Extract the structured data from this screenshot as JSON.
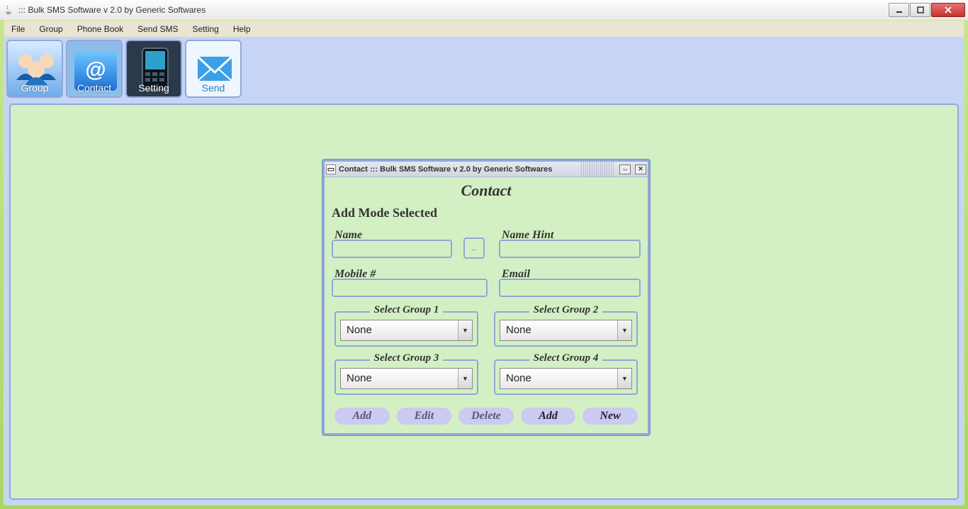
{
  "window": {
    "title": "::: Bulk SMS Software v 2.0 by Generic Softwares"
  },
  "menubar": [
    "File",
    "Group",
    "Phone Book",
    "Send SMS",
    "Setting",
    "Help"
  ],
  "toolbar": [
    {
      "id": "group",
      "label": "Group"
    },
    {
      "id": "contact",
      "label": "Contact"
    },
    {
      "id": "setting",
      "label": "Setting"
    },
    {
      "id": "send",
      "label": "Send"
    }
  ],
  "contactWindow": {
    "title": "Contact  ::: Bulk SMS Software v 2.0 by Generic Softwares",
    "heading": "Contact",
    "modeText": "Add Mode Selected",
    "fields": {
      "name": {
        "label": "Name",
        "value": ""
      },
      "nameHint": {
        "label": "Name Hint",
        "value": ""
      },
      "mobile": {
        "label": "Mobile #",
        "value": ""
      },
      "email": {
        "label": "Email",
        "value": ""
      }
    },
    "browseBtn": "...",
    "groups": [
      {
        "legend": "Select Group 1",
        "selected": "None"
      },
      {
        "legend": "Select Group 2",
        "selected": "None"
      },
      {
        "legend": "Select Group 3",
        "selected": "None"
      },
      {
        "legend": "Select Group 4",
        "selected": "None"
      }
    ],
    "buttons": [
      {
        "id": "add-disabled",
        "label": "Add",
        "enabled": false
      },
      {
        "id": "edit-disabled",
        "label": "Edit",
        "enabled": false
      },
      {
        "id": "delete-disabled",
        "label": "Delete",
        "enabled": false
      },
      {
        "id": "add",
        "label": "Add",
        "enabled": true
      },
      {
        "id": "new",
        "label": "New",
        "enabled": true
      }
    ]
  }
}
